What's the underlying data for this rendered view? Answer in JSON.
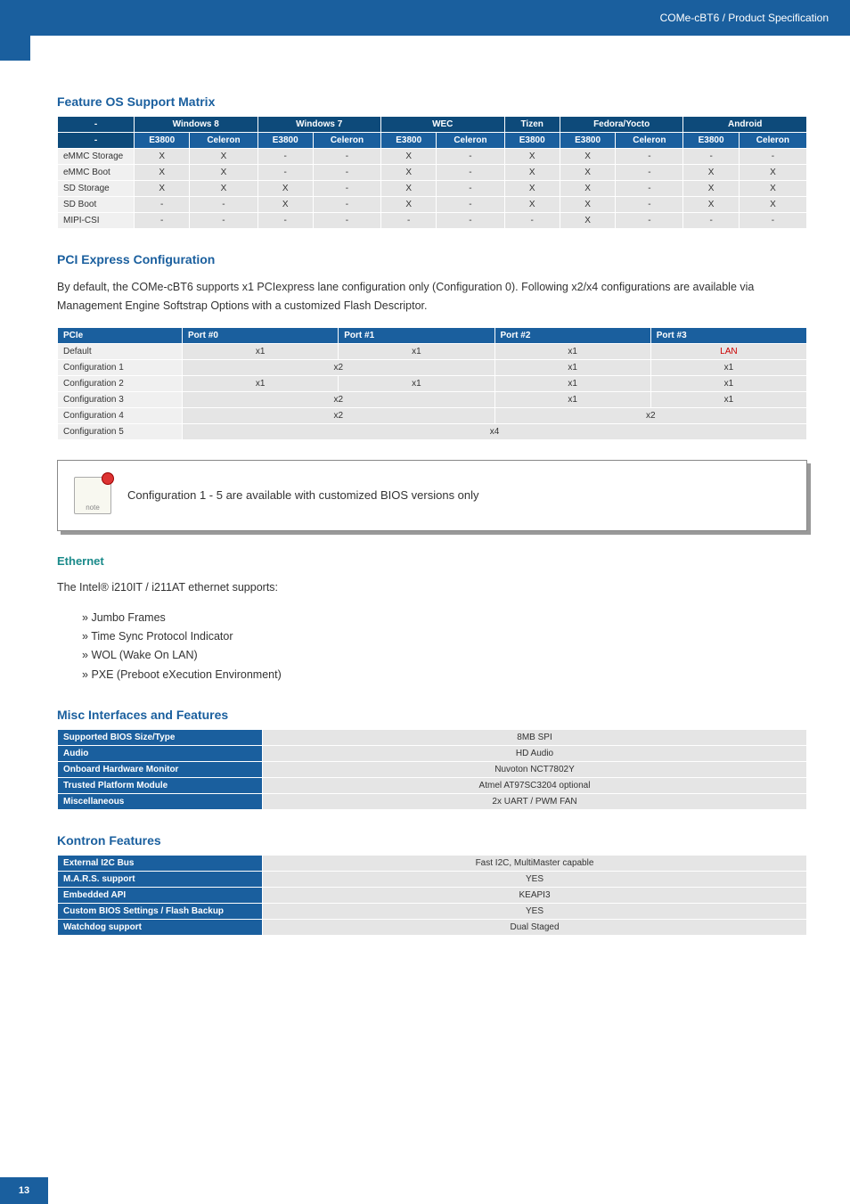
{
  "header": {
    "doc_title": "COMe-cBT6 / Product Specification"
  },
  "sections": {
    "os_support_title": "Feature OS Support Matrix",
    "pcie_title": "PCI Express Configuration",
    "pcie_desc": "By default, the COMe-cBT6 supports x1 PCIexpress lane configuration only (Configuration 0). Following x2/x4 configurations are available via Management Engine Softstrap Options with a customized Flash Descriptor.",
    "callout_text": "Configuration 1 - 5 are available with customized BIOS versions only",
    "ethernet_title": "Ethernet",
    "ethernet_desc": "The Intel® i210IT / i211AT ethernet supports:",
    "ethernet_items": {
      "i0": "Jumbo Frames",
      "i1": "Time Sync Protocol Indicator",
      "i2": "WOL (Wake On LAN)",
      "i3": "PXE (Preboot eXecution Environment)"
    },
    "misc_title": "Misc Interfaces and Features",
    "kontron_title": "Kontron Features"
  },
  "os_table": {
    "groups": {
      "g0": "-",
      "g1": "Windows 8",
      "g2": "Windows 7",
      "g3": "WEC",
      "g4": "Tizen",
      "g5": "Fedora/Yocto",
      "g6": "Android"
    },
    "sub": {
      "s0": "-",
      "e": "E3800",
      "c": "Celeron"
    },
    "rows": {
      "r0": {
        "label": "eMMC Storage",
        "v": [
          "X",
          "X",
          "-",
          "-",
          "X",
          "-",
          "X",
          "X",
          "-",
          "-",
          "-"
        ]
      },
      "r1": {
        "label": "eMMC Boot",
        "v": [
          "X",
          "X",
          "-",
          "-",
          "X",
          "-",
          "X",
          "X",
          "-",
          "X",
          "X"
        ]
      },
      "r2": {
        "label": "SD Storage",
        "v": [
          "X",
          "X",
          "X",
          "-",
          "X",
          "-",
          "X",
          "X",
          "-",
          "X",
          "X"
        ]
      },
      "r3": {
        "label": "SD Boot",
        "v": [
          "-",
          "-",
          "X",
          "-",
          "X",
          "-",
          "X",
          "X",
          "-",
          "X",
          "X"
        ]
      },
      "r4": {
        "label": "MIPI-CSI",
        "v": [
          "-",
          "-",
          "-",
          "-",
          "-",
          "-",
          "-",
          "X",
          "-",
          "-",
          "-"
        ]
      }
    }
  },
  "pcie_table": {
    "headers": {
      "h0": "PCIe",
      "h1": "Port #0",
      "h2": "Port #1",
      "h3": "Port #2",
      "h4": "Port #3"
    },
    "rows": {
      "default": {
        "label": "Default",
        "cells": [
          "x1",
          "x1",
          "x1",
          "LAN"
        ]
      },
      "c1": {
        "label": "Configuration 1",
        "span01": "x2",
        "cells23": [
          "x1",
          "x1"
        ]
      },
      "c2": {
        "label": "Configuration 2",
        "cells": [
          "x1",
          "x1",
          "x1",
          "x1"
        ]
      },
      "c3": {
        "label": "Configuration 3",
        "span01": "x2",
        "cells23": [
          "x1",
          "x1"
        ]
      },
      "c4": {
        "label": "Configuration 4",
        "span01": "x2",
        "span23": "x2"
      },
      "c5": {
        "label": "Configuration 5",
        "spanAll": "x4"
      }
    }
  },
  "misc_table": {
    "r0": {
      "k": "Supported BIOS Size/Type",
      "v": "8MB SPI"
    },
    "r1": {
      "k": "Audio",
      "v": "HD Audio"
    },
    "r2": {
      "k": "Onboard Hardware Monitor",
      "v": "Nuvoton NCT7802Y"
    },
    "r3": {
      "k": "Trusted Platform Module",
      "v": "Atmel AT97SC3204 optional"
    },
    "r4": {
      "k": "Miscellaneous",
      "v": "2x UART / PWM FAN"
    }
  },
  "kontron_table": {
    "r0": {
      "k": "External I2C Bus",
      "v": "Fast I2C, MultiMaster capable"
    },
    "r1": {
      "k": "M.A.R.S. support",
      "v": "YES"
    },
    "r2": {
      "k": "Embedded API",
      "v": "KEAPI3"
    },
    "r3": {
      "k": "Custom BIOS Settings / Flash Backup",
      "v": "YES"
    },
    "r4": {
      "k": "Watchdog support",
      "v": "Dual Staged"
    }
  },
  "page_number": "13",
  "chart_data": {
    "type": "table",
    "title": "Feature OS Support Matrix",
    "columns_top": [
      "-",
      "Windows 8",
      "Windows 7",
      "WEC",
      "Tizen",
      "Fedora/Yocto",
      "Android"
    ],
    "columns_sub": [
      "-",
      "E3800",
      "Celeron",
      "E3800",
      "Celeron",
      "E3800",
      "Celeron",
      "E3800",
      "E3800",
      "Celeron",
      "E3800",
      "Celeron"
    ],
    "rows": [
      {
        "label": "eMMC Storage",
        "values": [
          "X",
          "X",
          "-",
          "-",
          "X",
          "-",
          "X",
          "X",
          "-",
          "-",
          "-"
        ]
      },
      {
        "label": "eMMC Boot",
        "values": [
          "X",
          "X",
          "-",
          "-",
          "X",
          "-",
          "X",
          "X",
          "-",
          "X",
          "X"
        ]
      },
      {
        "label": "SD Storage",
        "values": [
          "X",
          "X",
          "X",
          "-",
          "X",
          "-",
          "X",
          "X",
          "-",
          "X",
          "X"
        ]
      },
      {
        "label": "SD Boot",
        "values": [
          "-",
          "-",
          "X",
          "-",
          "X",
          "-",
          "X",
          "X",
          "-",
          "X",
          "X"
        ]
      },
      {
        "label": "MIPI-CSI",
        "values": [
          "-",
          "-",
          "-",
          "-",
          "-",
          "-",
          "-",
          "X",
          "-",
          "-",
          "-"
        ]
      }
    ]
  }
}
